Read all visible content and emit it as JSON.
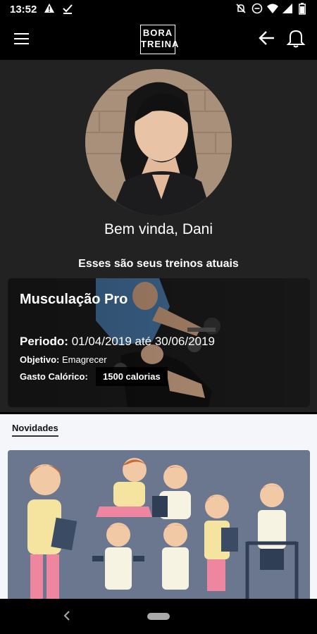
{
  "status": {
    "time": "13:52",
    "left_icons": [
      "alert-icon",
      "download-done-icon"
    ],
    "right_icons": [
      "mute-icon",
      "dnd-icon",
      "wifi-icon",
      "signal-icon",
      "battery-icon"
    ]
  },
  "appbar": {
    "logo_line1": "BORA",
    "logo_line2": "TREINA",
    "icons": [
      "menu-icon",
      "back-arrow-icon",
      "bell-icon"
    ]
  },
  "profile": {
    "greeting": "Bem vinda, Dani",
    "subtitle": "Esses são seus treinos atuais"
  },
  "workout_card": {
    "title": "Musculação Pro",
    "period_label": "Periodo:",
    "period_value": "01/04/2019 até 30/06/2019",
    "objective_label": "Objetivo:",
    "objective_value": "Emagrecer",
    "calories_label": "Gasto Calórico:",
    "calories_value": "1500 calorias"
  },
  "news": {
    "tab_label": "Novidades"
  },
  "colors": {
    "background": "#000000",
    "profile_bg": "#222222",
    "news_bg": "#f5f6fa",
    "news_image_bg": "#6b778f"
  }
}
